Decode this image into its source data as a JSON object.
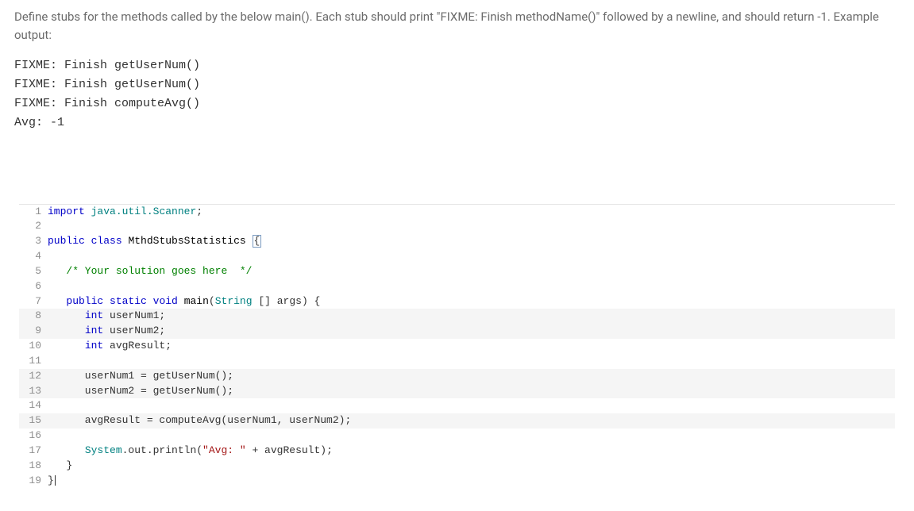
{
  "problem": {
    "instructions": "Define stubs for the methods called by the below main(). Each stub should print \"FIXME: Finish methodName()\" followed by a newline, and should return -1. Example output:",
    "example_lines": [
      "FIXME: Finish getUserNum()",
      "FIXME: Finish getUserNum()",
      "FIXME: Finish computeAvg()",
      "Avg: -1"
    ]
  },
  "code": {
    "lines": [
      {
        "n": 1,
        "alt": false,
        "tokens": [
          [
            "kw",
            "import"
          ],
          [
            "",
            " "
          ],
          [
            "pkg",
            "java.util.Scanner"
          ],
          [
            "",
            ";"
          ]
        ]
      },
      {
        "n": 2,
        "alt": false,
        "tokens": []
      },
      {
        "n": 3,
        "alt": false,
        "tokens": [
          [
            "kw",
            "public"
          ],
          [
            "",
            " "
          ],
          [
            "kw",
            "class"
          ],
          [
            "",
            " "
          ],
          [
            "id",
            "MthdStubsStatistics"
          ],
          [
            "",
            " "
          ],
          [
            "caret",
            "{"
          ]
        ]
      },
      {
        "n": 4,
        "alt": false,
        "tokens": []
      },
      {
        "n": 5,
        "alt": false,
        "tokens": [
          [
            "",
            "   "
          ],
          [
            "com",
            "/* Your solution goes here  */"
          ]
        ]
      },
      {
        "n": 6,
        "alt": false,
        "tokens": []
      },
      {
        "n": 7,
        "alt": false,
        "tokens": [
          [
            "",
            "   "
          ],
          [
            "kw",
            "public"
          ],
          [
            "",
            " "
          ],
          [
            "kw",
            "static"
          ],
          [
            "",
            " "
          ],
          [
            "type",
            "void"
          ],
          [
            "",
            " "
          ],
          [
            "id",
            "main"
          ],
          [
            "",
            "("
          ],
          [
            "pkg",
            "String"
          ],
          [
            "",
            " [] args) {"
          ]
        ]
      },
      {
        "n": 8,
        "alt": true,
        "tokens": [
          [
            "",
            "      "
          ],
          [
            "type",
            "int"
          ],
          [
            "",
            " userNum1;"
          ]
        ]
      },
      {
        "n": 9,
        "alt": true,
        "tokens": [
          [
            "",
            "      "
          ],
          [
            "type",
            "int"
          ],
          [
            "",
            " userNum2;"
          ]
        ]
      },
      {
        "n": 10,
        "alt": false,
        "tokens": [
          [
            "",
            "      "
          ],
          [
            "type",
            "int"
          ],
          [
            "",
            " avgResult;"
          ]
        ]
      },
      {
        "n": 11,
        "alt": false,
        "tokens": []
      },
      {
        "n": 12,
        "alt": true,
        "tokens": [
          [
            "",
            "      userNum1 = getUserNum();"
          ]
        ]
      },
      {
        "n": 13,
        "alt": true,
        "tokens": [
          [
            "",
            "      userNum2 = getUserNum();"
          ]
        ]
      },
      {
        "n": 14,
        "alt": false,
        "tokens": []
      },
      {
        "n": 15,
        "alt": true,
        "tokens": [
          [
            "",
            "      avgResult = computeAvg(userNum1, userNum2);"
          ]
        ]
      },
      {
        "n": 16,
        "alt": false,
        "tokens": []
      },
      {
        "n": 17,
        "alt": false,
        "tokens": [
          [
            "",
            "      "
          ],
          [
            "pkg",
            "System"
          ],
          [
            "",
            ".out.println("
          ],
          [
            "str",
            "\"Avg: \""
          ],
          [
            "",
            " + avgResult);"
          ]
        ]
      },
      {
        "n": 18,
        "alt": false,
        "tokens": [
          [
            "",
            "   }"
          ]
        ]
      },
      {
        "n": 19,
        "alt": false,
        "tokens": [
          [
            "",
            "}"
          ],
          [
            "endcaret",
            ""
          ]
        ]
      }
    ]
  }
}
